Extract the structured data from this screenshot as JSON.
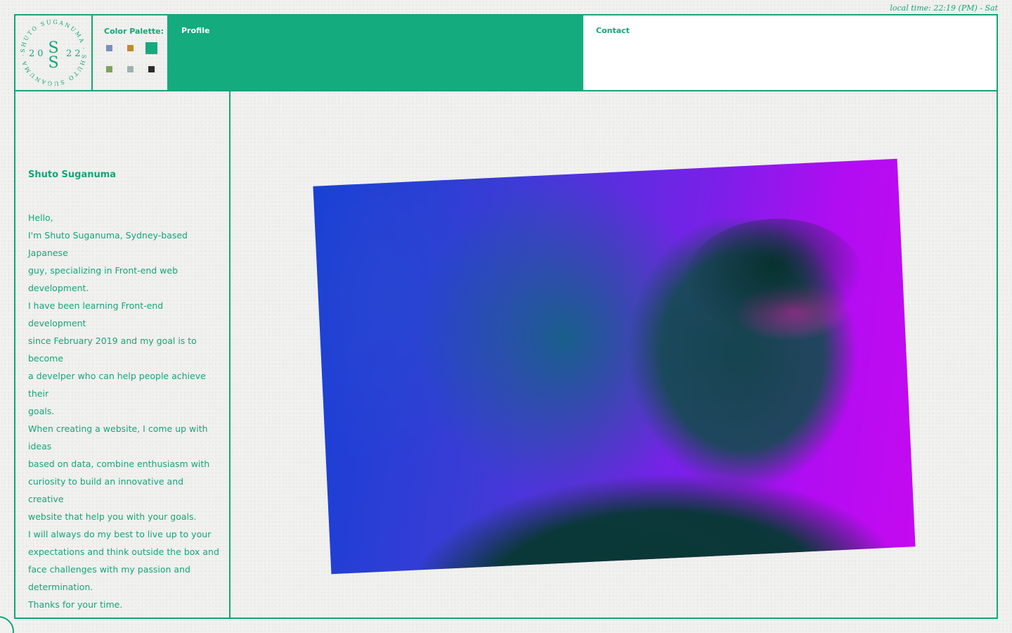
{
  "header": {
    "local_time": "local time: 22:19 (PM) - Sat",
    "logo": {
      "ring_text": "SHUTO SUGANUMA · SHUTO SUGANUMA ·",
      "year_left": "20",
      "year_right": "22",
      "monogram_top": "S",
      "monogram_bottom": "S"
    },
    "palette": {
      "title": "Color Palette:",
      "swatches": [
        "#7b8fbf",
        "#c08a2e",
        "#14ab7e",
        "#7fa35d",
        "#9fb2b3",
        "#2b2b2b"
      ]
    },
    "nav": {
      "profile": "Profile",
      "contact": "Contact"
    },
    "accent_color": "#14ab7e"
  },
  "sidebar": {
    "name": "Shuto Suganuma",
    "bio": [
      "Hello,",
      "I'm Shuto Suganuma, Sydney-based Japanese\nguy, specializing in Front-end web\ndevelopment.",
      "I have been learning Front-end development\nsince February 2019 and my goal is to become\na develper who can help people achieve their\ngoals.",
      "When creating a website, I come up with ideas\nbased on data, combine enthusiasm with\ncuriosity to build an innovative and creative\nwebsite that help you with your goals.",
      "I will always do my best to live up to your\nexpectations and think outside the box and\nface challenges with my passion and\ndetermination.",
      "Thanks for your time."
    ]
  },
  "main": {
    "photo_icon": "portrait-photo"
  }
}
